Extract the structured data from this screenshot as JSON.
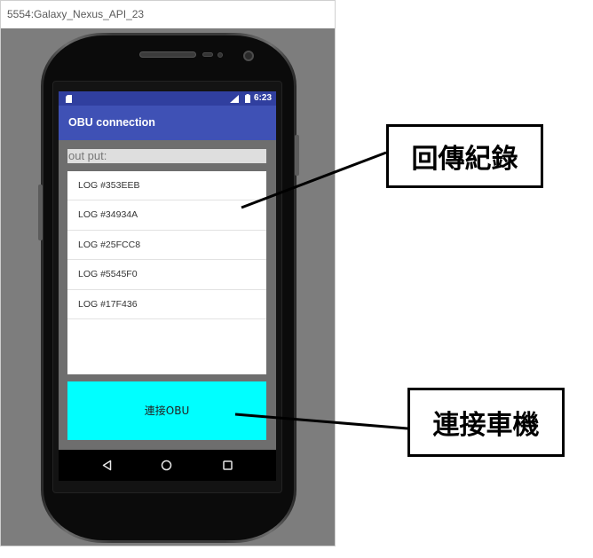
{
  "emulator": {
    "title": "5554:Galaxy_Nexus_API_23"
  },
  "status_bar": {
    "time": "6:23",
    "icons": [
      "sd-card-icon",
      "signal-icon",
      "battery-icon"
    ]
  },
  "app_bar": {
    "title": "OBU connection"
  },
  "output": {
    "text": "out put:"
  },
  "log_list": {
    "items": [
      "LOG #353EEB",
      "LOG #34934A",
      "LOG #25FCC8",
      "LOG #5545F0",
      "LOG #17F436"
    ]
  },
  "connect_button": {
    "label": "連接OBU"
  },
  "nav_bar": {
    "icons": [
      "back-icon",
      "home-icon",
      "recents-icon"
    ]
  },
  "annotations": [
    {
      "text": "回傳紀錄"
    },
    {
      "text": "連接車機"
    }
  ],
  "colors": {
    "emulator_background": "#7d7d7d",
    "status_bar": "#303f9f",
    "app_bar": "#3f51b5",
    "content_background": "#6e6e6e",
    "output_background": "#dedede",
    "connect_button": "#00ffff",
    "annotation_border": "#000000"
  }
}
